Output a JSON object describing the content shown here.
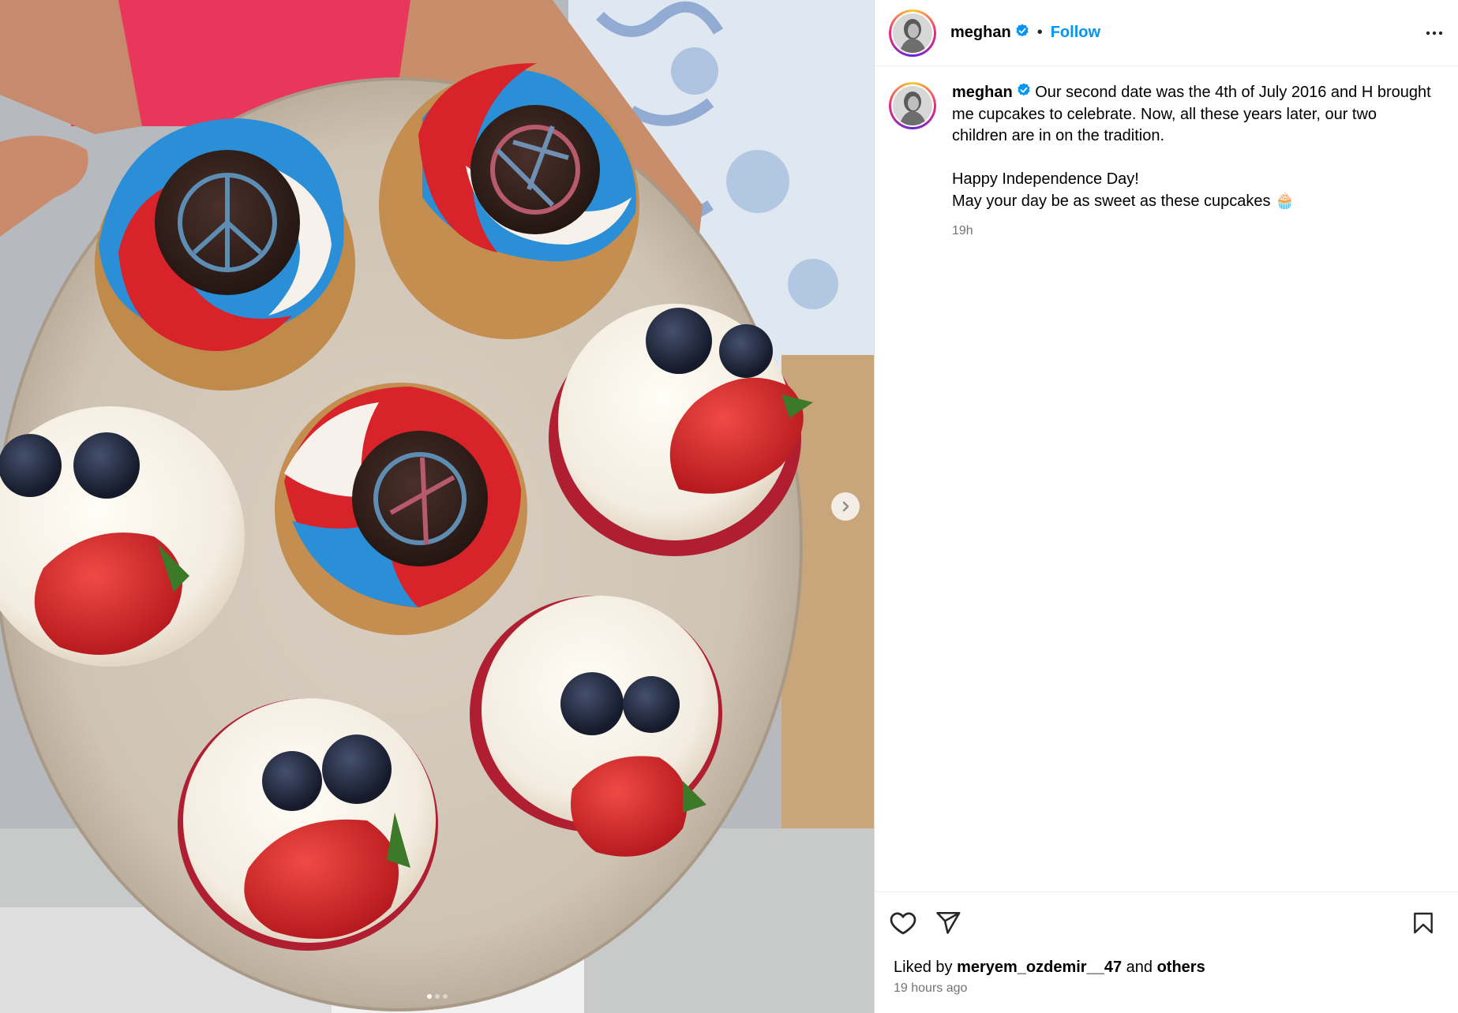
{
  "post": {
    "username": "meghan",
    "separator": "•",
    "follow_label": "Follow",
    "caption": {
      "username": "meghan",
      "text": " Our second date was the 4th of July 2016 and H brought me cupcakes to celebrate. Now, all these years later, our two children are in on the tradition.\n\nHappy Independence Day!\nMay your day be as sweet as these cupcakes 🧁",
      "time": "19h"
    },
    "likes": {
      "prefix": "Liked by ",
      "user": "meryem_ozdemir__47",
      "middle": " and ",
      "others": "others"
    },
    "posted_ago": "19 hours ago",
    "carousel": {
      "slides": 3,
      "active": 1
    }
  },
  "icons": {
    "verified": "verified-badge-icon",
    "more": "more-options-icon",
    "next": "chevron-right-icon",
    "like": "heart-icon",
    "share": "send-icon",
    "save": "bookmark-icon"
  },
  "colors": {
    "accent": "#0095f6",
    "verified": "#0095f6",
    "muted": "#737373",
    "border": "#dbdbdb"
  }
}
